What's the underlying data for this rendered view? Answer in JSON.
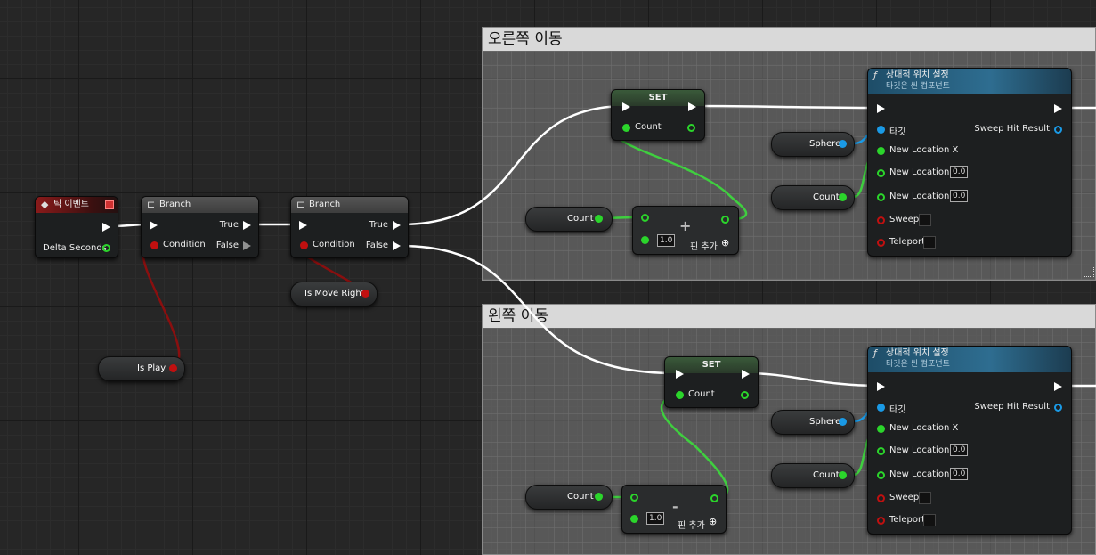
{
  "comments": {
    "right_move": "오른쪽 이동",
    "left_move": "왼쪽 이동"
  },
  "tick_event": {
    "title": "틱 이벤트",
    "delta_seconds": "Delta Seconds"
  },
  "branch1": {
    "title": "Branch",
    "condition": "Condition",
    "true_label": "True",
    "false_label": "False"
  },
  "branch2": {
    "title": "Branch",
    "condition": "Condition",
    "true_label": "True",
    "false_label": "False"
  },
  "is_play": "Is Play",
  "is_move_right": "Is Move Right",
  "set_right": {
    "title": "SET",
    "count": "Count"
  },
  "set_left": {
    "title": "SET",
    "count": "Count"
  },
  "count_get_right": "Count",
  "count_get_left": "Count",
  "add_node": {
    "symbol": "+",
    "value": "1.0",
    "add_pin": "핀 추가"
  },
  "sub_node": {
    "symbol": "-",
    "value": "1.0",
    "add_pin": "핀 추가"
  },
  "sphere_right": "Sphere",
  "sphere_left": "Sphere",
  "count_loc_right": "Count",
  "count_loc_left": "Count",
  "func_right": {
    "title": "상대적 위치 설정",
    "subtitle": "타깃은 씬 컴포넌트",
    "target": "타깃",
    "sweep_hit": "Sweep Hit Result",
    "new_x": "New Location X",
    "new_y": "New Location Y",
    "new_y_val": "0.0",
    "new_z": "New Location Z",
    "new_z_val": "0.0",
    "sweep": "Sweep",
    "teleport": "Teleport"
  },
  "func_left": {
    "title": "상대적 위치 설정",
    "subtitle": "타깃은 씬 컴포넌트",
    "target": "타깃",
    "sweep_hit": "Sweep Hit Result",
    "new_x": "New Location X",
    "new_y": "New Location Y",
    "new_y_val": "0.0",
    "new_z": "New Location Z",
    "new_z_val": "0.0",
    "sweep": "Sweep",
    "teleport": "Teleport"
  },
  "colors": {
    "exec_wire": "#ffffff",
    "float_wire": "#3fcf3f",
    "bool_wire": "#8a0f0f",
    "object_wire": "#1a9ae6"
  },
  "icons": {
    "event": "diamond-event-icon",
    "branch": "branch-icon",
    "function": "function-f-icon",
    "add_pin": "plus-circle-icon"
  }
}
